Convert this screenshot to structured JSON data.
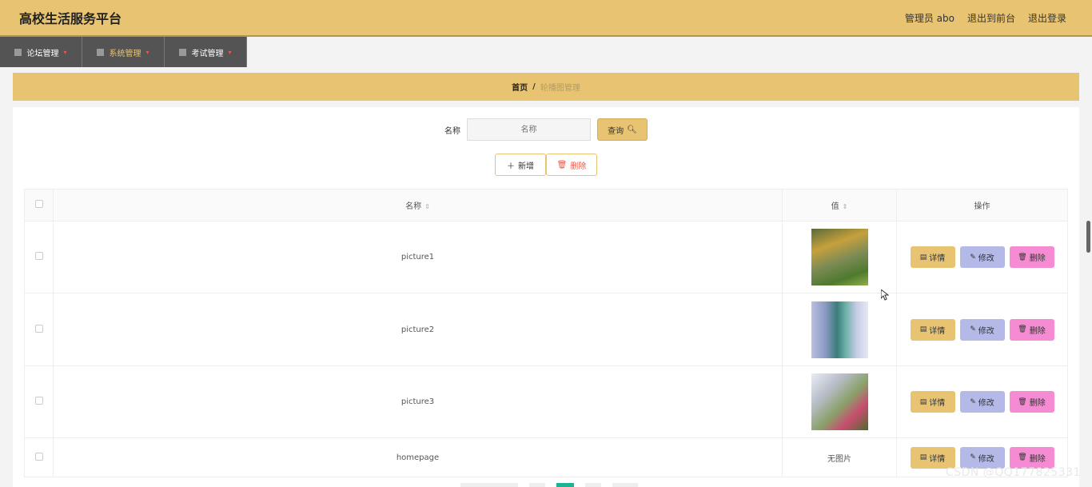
{
  "header": {
    "title": "高校生活服务平台",
    "admin": "管理员 abo",
    "to_front": "退出到前台",
    "logout": "退出登录"
  },
  "nav": {
    "items": [
      {
        "label": "论坛管理",
        "icon": "pin-icon"
      },
      {
        "label": "系统管理",
        "icon": "send-icon"
      },
      {
        "label": "考试管理",
        "icon": "monitor-icon"
      }
    ]
  },
  "breadcrumb": {
    "home": "首页",
    "sep": "/",
    "current": "轮播图管理"
  },
  "search": {
    "label": "名称",
    "placeholder": "名称",
    "button": "查询"
  },
  "actions": {
    "add": "新增",
    "delete": "删除"
  },
  "table": {
    "headers": {
      "name": "名称",
      "value": "值",
      "ops": "操作"
    },
    "rows": [
      {
        "name": "picture1",
        "value": ""
      },
      {
        "name": "picture2",
        "value": ""
      },
      {
        "name": "picture3",
        "value": ""
      },
      {
        "name": "homepage",
        "value": "无图片"
      }
    ],
    "op_labels": {
      "detail": "详情",
      "edit": "修改",
      "delete": "删除"
    }
  },
  "watermark": "CSDN @QQ177825331",
  "colors": {
    "accent": "#e8c472",
    "nav": "#545454",
    "edit": "#b4b9e8",
    "delete": "#f58bd2"
  }
}
